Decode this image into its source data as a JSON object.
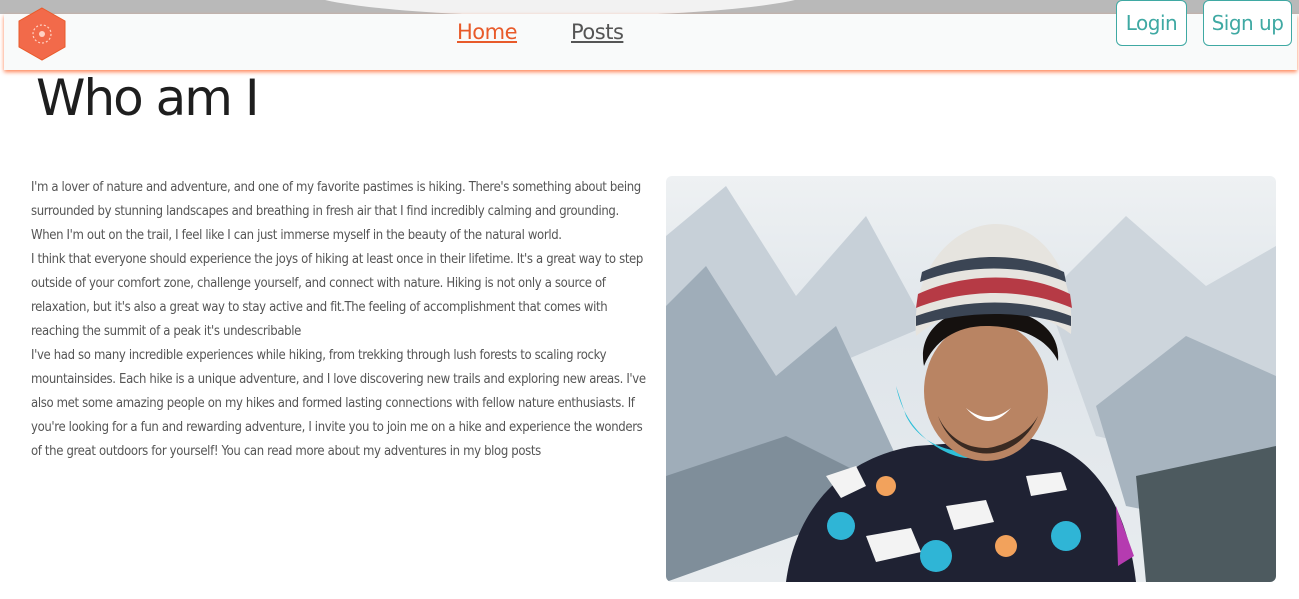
{
  "nav": {
    "logo_icon": "hexagon-logo-icon",
    "links": [
      {
        "label": "Home",
        "active": true
      },
      {
        "label": "Posts",
        "active": false
      }
    ],
    "login_label": "Login",
    "signup_label": "Sign up"
  },
  "main": {
    "title": "Who am I",
    "paragraphs": [
      "I'm a lover of nature and adventure, and one of my favorite pastimes is hiking. There's something about being surrounded by stunning landscapes and breathing in fresh air that I find incredibly calming and grounding. When I'm out on the trail, I feel like I can just immerse myself in the beauty of the natural world.",
      "I think that everyone should experience the joys of hiking at least once in their lifetime. It's a great way to step outside of your comfort zone, challenge yourself, and connect with nature. Hiking is not only a source of relaxation, but it's also a great way to stay active and fit.The feeling of accomplishment that comes with reaching the summit of a peak it's undescribable",
      "I've had so many incredible experiences while hiking, from trekking through lush forests to scaling rocky mountainsides. Each hike is a unique adventure, and I love discovering new trails and exploring new areas. I've also met some amazing people on my hikes and formed lasting connections with fellow nature enthusiasts. If you're looking for a fun and rewarding adventure, I invite you to join me on a hike and experience the wonders of the great outdoors for yourself! You can read more about my adventures in my blog posts"
    ],
    "photo_icon": "hiker-portrait-photo"
  },
  "colors": {
    "accent_orange": "#e85a2a",
    "teal": "#3fa9a3",
    "nav_shadow": "#ff7846"
  }
}
